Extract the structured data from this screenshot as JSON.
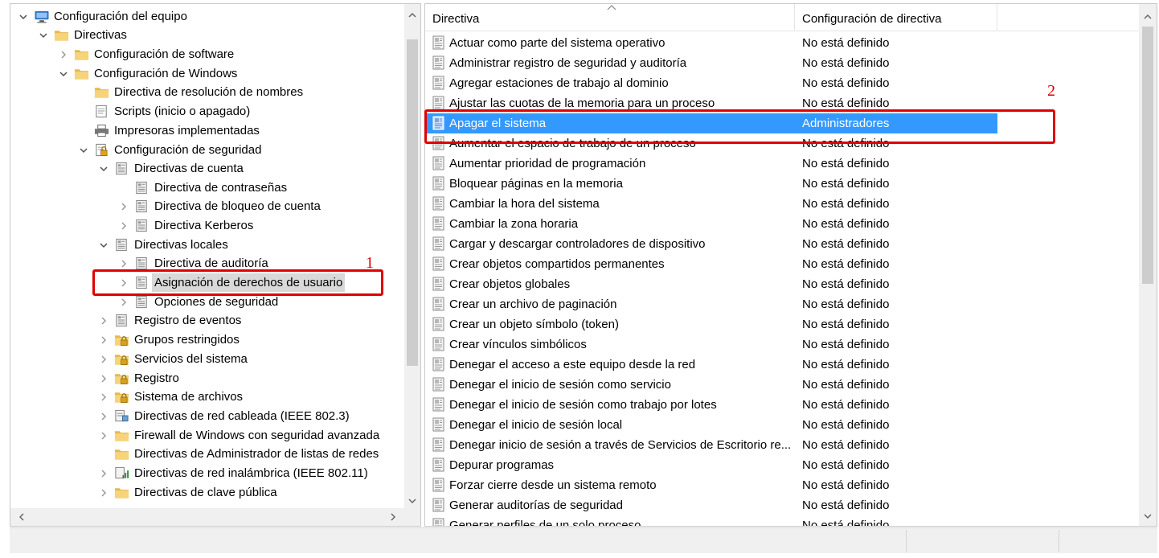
{
  "tree": {
    "items": [
      {
        "label": "Configuración del equipo",
        "expander": "expanded",
        "icon": "computer-icon"
      },
      {
        "label": "Directivas",
        "expander": "expanded",
        "icon": "folder-icon"
      },
      {
        "label": "Configuración de software",
        "expander": "collapsed",
        "icon": "folder-icon"
      },
      {
        "label": "Configuración de Windows",
        "expander": "expanded",
        "icon": "folder-icon"
      },
      {
        "label": "Directiva de resolución de nombres",
        "expander": "none",
        "icon": "folder-icon"
      },
      {
        "label": "Scripts (inicio o apagado)",
        "expander": "none",
        "icon": "script-icon"
      },
      {
        "label": "Impresoras implementadas",
        "expander": "none",
        "icon": "printer-icon"
      },
      {
        "label": "Configuración de seguridad",
        "expander": "expanded",
        "icon": "security-settings-icon"
      },
      {
        "label": "Directivas de cuenta",
        "expander": "expanded",
        "icon": "policy-book-icon"
      },
      {
        "label": "Directiva de contraseñas",
        "expander": "none",
        "icon": "policy-book-icon"
      },
      {
        "label": "Directiva de bloqueo de cuenta",
        "expander": "collapsed",
        "icon": "policy-book-icon"
      },
      {
        "label": "Directiva Kerberos",
        "expander": "collapsed",
        "icon": "policy-book-icon"
      },
      {
        "label": "Directivas locales",
        "expander": "expanded",
        "icon": "policy-book-icon"
      },
      {
        "label": "Directiva de auditoría",
        "expander": "collapsed",
        "icon": "policy-book-icon"
      },
      {
        "label": "Asignación de derechos de usuario",
        "expander": "collapsed",
        "icon": "policy-book-icon",
        "selected": true
      },
      {
        "label": "Opciones de seguridad",
        "expander": "collapsed",
        "icon": "policy-book-icon"
      },
      {
        "label": "Registro de eventos",
        "expander": "collapsed",
        "icon": "policy-book-icon"
      },
      {
        "label": "Grupos restringidos",
        "expander": "collapsed",
        "icon": "locked-folder-icon"
      },
      {
        "label": "Servicios del sistema",
        "expander": "collapsed",
        "icon": "locked-folder-icon"
      },
      {
        "label": "Registro",
        "expander": "collapsed",
        "icon": "locked-folder-icon"
      },
      {
        "label": "Sistema de archivos",
        "expander": "collapsed",
        "icon": "locked-folder-icon"
      },
      {
        "label": "Directivas de red cableada (IEEE 802.3)",
        "expander": "collapsed",
        "icon": "wired-network-icon"
      },
      {
        "label": "Firewall de Windows con seguridad avanzada",
        "expander": "collapsed",
        "icon": "folder-icon"
      },
      {
        "label": "Directivas de Administrador de listas de redes",
        "expander": "none",
        "icon": "folder-icon"
      },
      {
        "label": "Directivas de red inalámbrica (IEEE 802.11)",
        "expander": "collapsed",
        "icon": "wireless-network-icon"
      },
      {
        "label": "Directivas de clave pública",
        "expander": "collapsed",
        "icon": "folder-icon"
      }
    ]
  },
  "list": {
    "columns": {
      "directiva": "Directiva",
      "config": "Configuración de directiva"
    },
    "rows": [
      {
        "name": "Actuar como parte del sistema operativo",
        "value": "No está definido"
      },
      {
        "name": "Administrar registro de seguridad y auditoría",
        "value": "No está definido"
      },
      {
        "name": "Agregar estaciones de trabajo al dominio",
        "value": "No está definido"
      },
      {
        "name": "Ajustar las cuotas de la memoria para un proceso",
        "value": "No está definido"
      },
      {
        "name": "Apagar el sistema",
        "value": "Administradores",
        "selected": true
      },
      {
        "name": "Aumentar el espacio de trabajo de un proceso",
        "value": "No está definido"
      },
      {
        "name": "Aumentar prioridad de programación",
        "value": "No está definido"
      },
      {
        "name": "Bloquear páginas en la memoria",
        "value": "No está definido"
      },
      {
        "name": "Cambiar la hora del sistema",
        "value": "No está definido"
      },
      {
        "name": "Cambiar la zona horaria",
        "value": "No está definido"
      },
      {
        "name": "Cargar y descargar controladores de dispositivo",
        "value": "No está definido"
      },
      {
        "name": "Crear objetos compartidos permanentes",
        "value": "No está definido"
      },
      {
        "name": "Crear objetos globales",
        "value": "No está definido"
      },
      {
        "name": "Crear un archivo de paginación",
        "value": "No está definido"
      },
      {
        "name": "Crear un objeto símbolo (token)",
        "value": "No está definido"
      },
      {
        "name": "Crear vínculos simbólicos",
        "value": "No está definido"
      },
      {
        "name": "Denegar el acceso a este equipo desde la red",
        "value": "No está definido"
      },
      {
        "name": "Denegar el inicio de sesión como servicio",
        "value": "No está definido"
      },
      {
        "name": "Denegar el inicio de sesión como trabajo por lotes",
        "value": "No está definido"
      },
      {
        "name": "Denegar el inicio de sesión local",
        "value": "No está definido"
      },
      {
        "name": "Denegar inicio de sesión a través de Servicios de Escritorio re...",
        "value": "No está definido"
      },
      {
        "name": "Depurar programas",
        "value": "No está definido"
      },
      {
        "name": "Forzar cierre desde un sistema remoto",
        "value": "No está definido"
      },
      {
        "name": "Generar auditorías de seguridad",
        "value": "No está definido"
      },
      {
        "name": "Generar perfiles de un solo proceso",
        "value": "No está definido"
      }
    ]
  },
  "annotations": {
    "callout_1": "1",
    "callout_2": "2"
  },
  "colors": {
    "selection": "#3399ff",
    "tree_selection": "#d9d9d9",
    "callout": "#e00000",
    "folder": "#f4d06f"
  }
}
